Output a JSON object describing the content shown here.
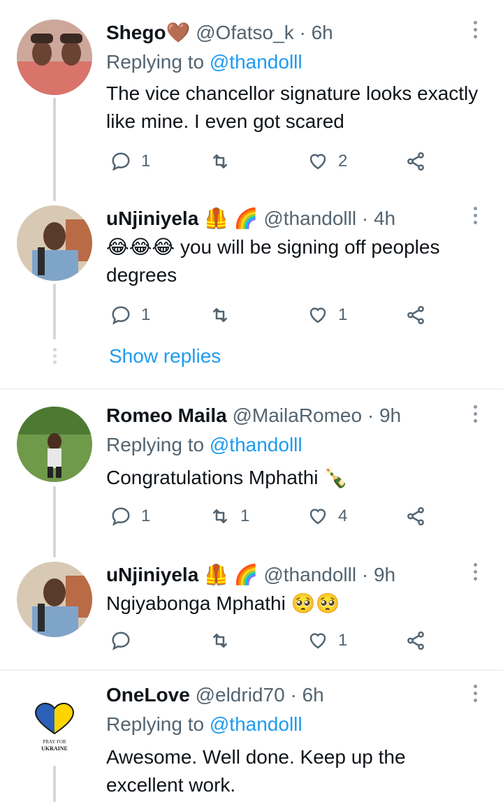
{
  "tweets": [
    {
      "name": "Shego",
      "name_emoji": "🤎",
      "handle": "@Ofatso_k",
      "time": "· 6h",
      "replying_prefix": "Replying to",
      "replying_handle": "@thandolll",
      "text": "The vice chancellor signature looks exactly like mine. I even got scared",
      "replies": "1",
      "retweets": "",
      "likes": "2"
    },
    {
      "name": "uNjiniyela",
      "name_emoji": "🦺 🌈",
      "handle": "@thandolll",
      "time": "· 4h",
      "emoji_prefix": "😂😂😂",
      "text": "you will be signing off peoples degrees",
      "replies": "1",
      "retweets": "",
      "likes": "1"
    },
    {
      "name": "Romeo Maila",
      "handle": "@MailaRomeo",
      "time": "· 9h",
      "replying_prefix": "Replying to",
      "replying_handle": "@thandolll",
      "text": "Congratulations Mphathi",
      "text_emoji": "🍾",
      "replies": "1",
      "retweets": "1",
      "likes": "4"
    },
    {
      "name": "uNjiniyela",
      "name_emoji": "🦺 🌈",
      "handle": "@thandolll",
      "time": "· 9h",
      "text": "Ngiyabonga Mphathi",
      "text_emoji": "🥺🥺",
      "replies": "",
      "retweets": "",
      "likes": "1"
    },
    {
      "name": "OneLove",
      "handle": "@eldrid70",
      "time": "· 6h",
      "replying_prefix": "Replying to",
      "replying_handle": "@thandolll",
      "text": "Awesome. Well done. Keep up the excellent work.",
      "avatar_text_1": "PRAY FOR",
      "avatar_text_2": "UKRAINE"
    }
  ],
  "show_replies": "Show replies",
  "colors": {
    "accent": "#1d9bf0",
    "secondary_text": "#536471",
    "line": "#cfd9de"
  },
  "icons": [
    "reply-icon",
    "retweet-icon",
    "like-icon",
    "share-icon",
    "more-icon"
  ]
}
